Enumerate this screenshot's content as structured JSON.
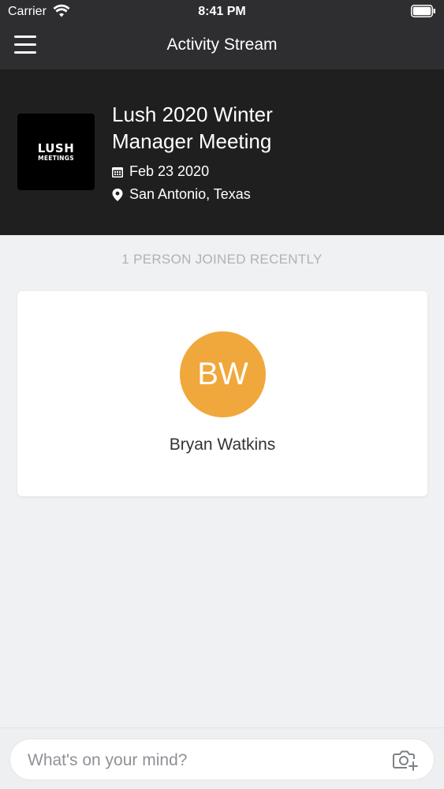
{
  "status_bar": {
    "carrier": "Carrier",
    "time": "8:41 PM"
  },
  "nav": {
    "title": "Activity Stream",
    "menu_icon": "hamburger-menu-icon"
  },
  "event": {
    "logo_line1": "LUSH",
    "logo_line2": "MEETINGS",
    "title": "Lush 2020 Winter Manager Meeting",
    "date": "Feb 23 2020",
    "location": "San Antonio, Texas",
    "date_icon": "calendar-icon",
    "location_icon": "location-pin-icon"
  },
  "joined": {
    "heading": "1 PERSON JOINED RECENTLY",
    "people": [
      {
        "initials": "BW",
        "name": "Bryan Watkins",
        "avatar_color": "#f0a83c"
      }
    ]
  },
  "composer": {
    "placeholder": "What's on your mind?",
    "camera_icon": "camera-add-icon"
  },
  "colors": {
    "header_bg": "#2e2e30",
    "event_bg": "#1f1f20",
    "page_bg": "#f0f1f3",
    "accent_avatar": "#f0a83c"
  }
}
